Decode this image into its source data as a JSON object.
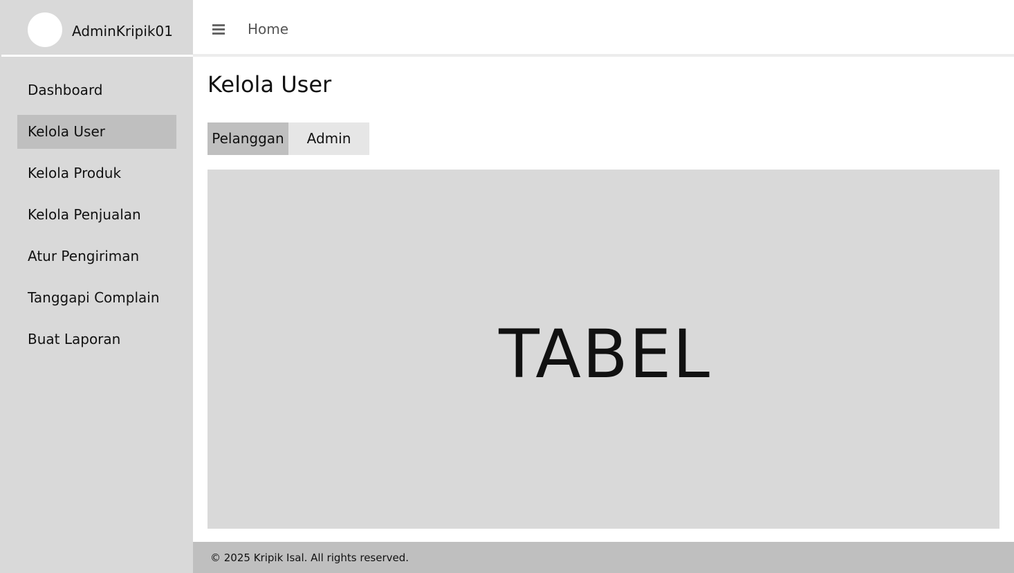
{
  "user": {
    "name": "AdminKripik01"
  },
  "sidebar": {
    "items": [
      {
        "label": "Dashboard"
      },
      {
        "label": "Kelola User"
      },
      {
        "label": "Kelola Produk"
      },
      {
        "label": "Kelola Penjualan"
      },
      {
        "label": "Atur Pengiriman"
      },
      {
        "label": "Tanggapi Complain"
      },
      {
        "label": "Buat Laporan"
      }
    ],
    "active_index": 1
  },
  "topbar": {
    "menu_icon": "hamburger-menu-icon",
    "home_label": "Home"
  },
  "main": {
    "title": "Kelola User",
    "tabs": [
      {
        "label": "Pelanggan",
        "active": true
      },
      {
        "label": "Admin",
        "active": false
      }
    ],
    "table_placeholder": "TABEL"
  },
  "footer": {
    "text": "© 2025 Kripik Isal. All rights reserved."
  },
  "colors": {
    "sidebar_bg": "#d9d9d9",
    "active_bg": "#bfbfbf",
    "inactive_tab_bg": "#e6e6e6",
    "footer_bg": "#bfbfbf",
    "content_bg": "#ffffff"
  }
}
